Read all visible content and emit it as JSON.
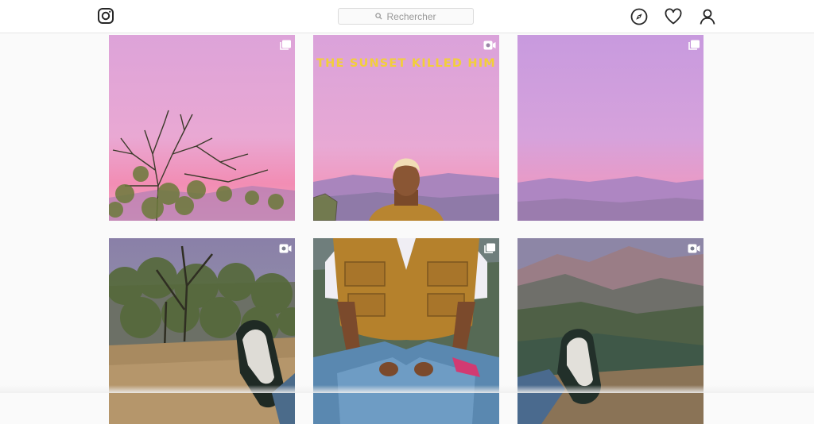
{
  "app": {
    "name": "Instagram"
  },
  "header": {
    "logo_icon": "instagram-icon",
    "search": {
      "placeholder": "Rechercher",
      "icon": "search-icon"
    },
    "nav_icons": [
      "compass-icon",
      "heart-icon",
      "user-icon"
    ]
  },
  "grid": {
    "posts": [
      {
        "kind": "album",
        "scene": "pink-sky-tree"
      },
      {
        "kind": "video",
        "scene": "pink-sky-person",
        "overlay_text": "THE SUNSET KILLED HIM"
      },
      {
        "kind": "album",
        "scene": "pink-sky-mountains"
      },
      {
        "kind": "video",
        "scene": "hill-tree-sneaker"
      },
      {
        "kind": "album",
        "scene": "seated-person-vest"
      },
      {
        "kind": "video",
        "scene": "valley-sneaker"
      }
    ]
  },
  "colors": {
    "sky_top": "#d9a0d6",
    "sky_horizon": "#f08fb6",
    "mountains": "#a979b9",
    "caption": "#f2cf3a",
    "ground": "#a8895f",
    "vest": "#b88530"
  }
}
